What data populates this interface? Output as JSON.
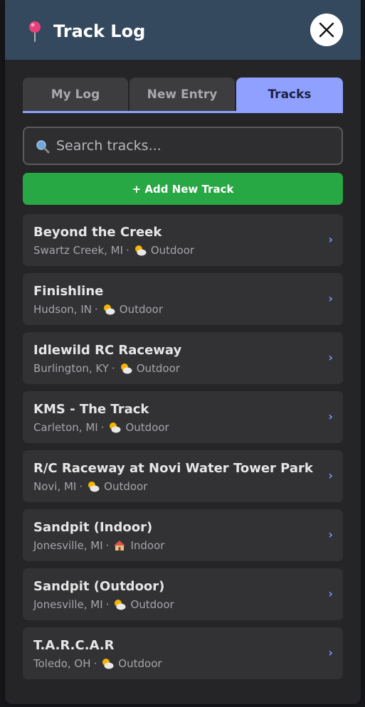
{
  "header": {
    "title": "Track Log",
    "pin_icon": "round-pushpin-icon",
    "close_icon": "close-icon"
  },
  "tabs": [
    {
      "label": "My Log",
      "active": false
    },
    {
      "label": "New Entry",
      "active": false
    },
    {
      "label": "Tracks",
      "active": true
    }
  ],
  "search": {
    "placeholder": "Search tracks...",
    "value": "",
    "icon": "magnifier-icon"
  },
  "add_button": {
    "label": "+ Add New Track"
  },
  "tracks": [
    {
      "name": "Beyond the Creek",
      "location": "Swartz Creek, MI",
      "env": "Outdoor",
      "env_icon": "sun-cloud-icon"
    },
    {
      "name": "Finishline",
      "location": "Hudson, IN",
      "env": "Outdoor",
      "env_icon": "sun-cloud-icon"
    },
    {
      "name": "Idlewild RC Raceway",
      "location": "Burlington, KY",
      "env": "Outdoor",
      "env_icon": "sun-cloud-icon"
    },
    {
      "name": "KMS - The Track",
      "location": "Carleton, MI",
      "env": "Outdoor",
      "env_icon": "sun-cloud-icon"
    },
    {
      "name": "R/C Raceway at Novi Water Tower Park",
      "location": "Novi, MI",
      "env": "Outdoor",
      "env_icon": "sun-cloud-icon"
    },
    {
      "name": "Sandpit (Indoor)",
      "location": "Jonesville, MI",
      "env": "Indoor",
      "env_icon": "house-icon"
    },
    {
      "name": "Sandpit (Outdoor)",
      "location": "Jonesville, MI",
      "env": "Outdoor",
      "env_icon": "sun-cloud-icon"
    },
    {
      "name": "T.A.R.C.A.R",
      "location": "Toledo, OH",
      "env": "Outdoor",
      "env_icon": "sun-cloud-icon"
    }
  ],
  "separator": "·",
  "chevron": "›",
  "colors": {
    "header_bg": "#34495e",
    "accent": "#8fa0ff",
    "add_button": "#28a745",
    "card_bg": "#323235"
  }
}
